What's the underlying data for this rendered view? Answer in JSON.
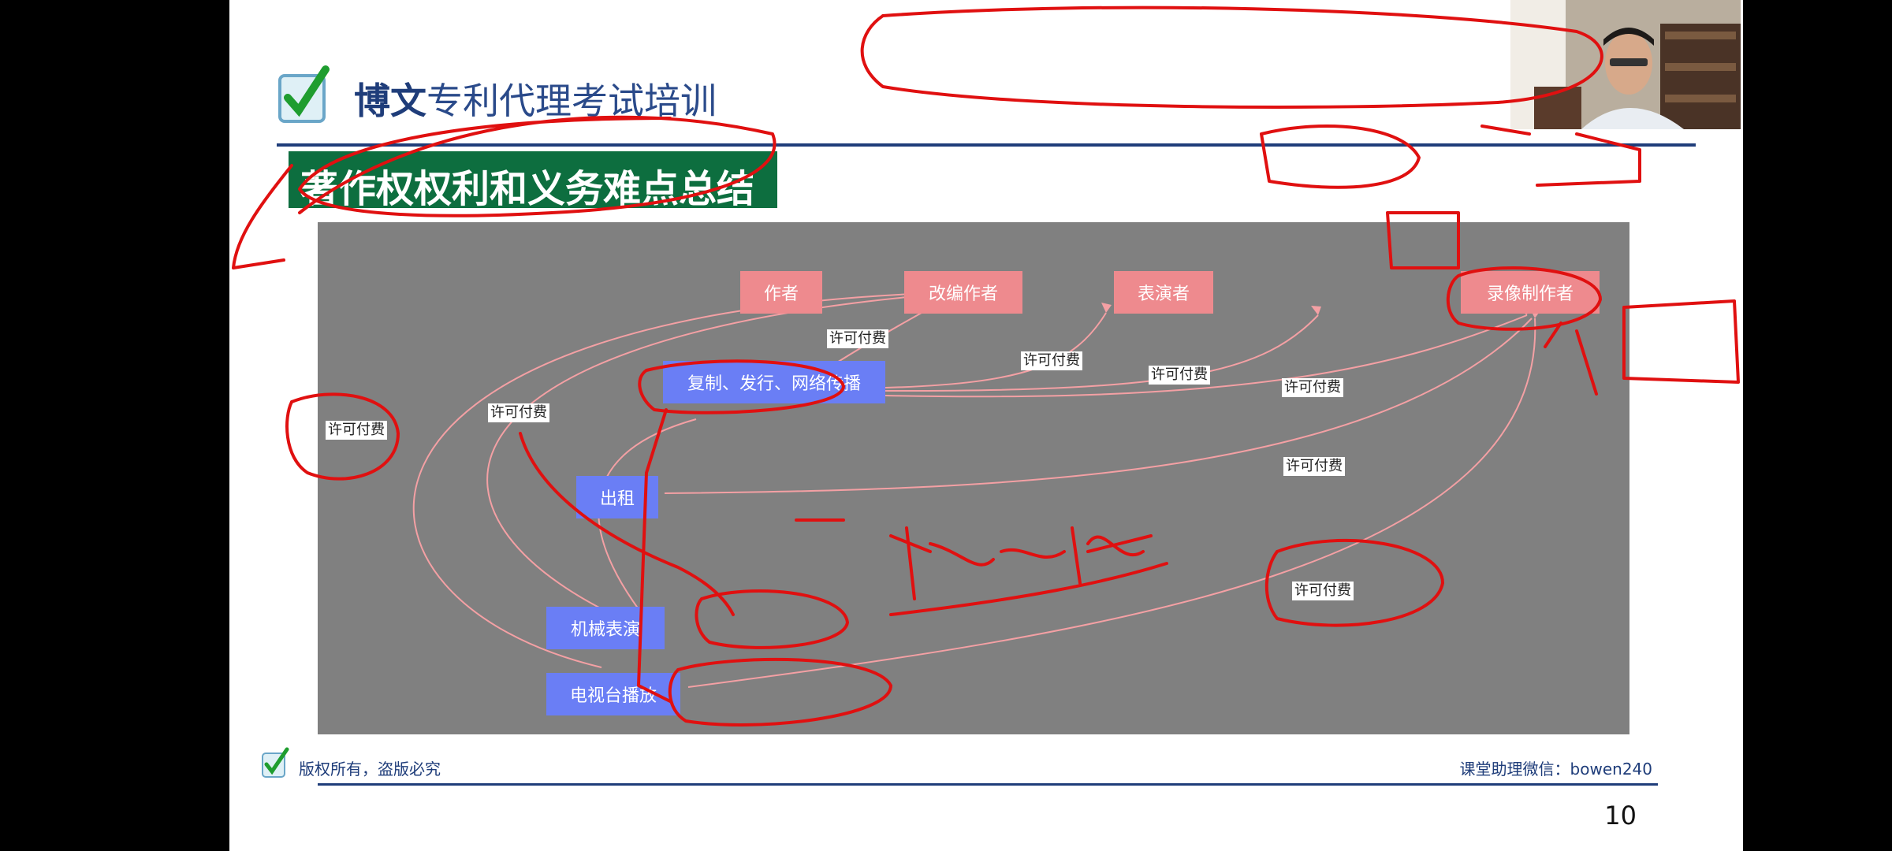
{
  "slide": {
    "brand_bold": "博文",
    "brand_rest": "专利代理考试培训",
    "title": "著作权权利和义务难点总结",
    "footer_left": "版权所有，盗版必究",
    "footer_right": "课堂助理微信：bowen240",
    "page_number": "10"
  },
  "diagram": {
    "rights_holders": [
      {
        "id": "author",
        "label": "作者"
      },
      {
        "id": "adapter",
        "label": "改编作者"
      },
      {
        "id": "performer",
        "label": "表演者"
      },
      {
        "id": "producer",
        "label": "录像制作者"
      }
    ],
    "uses": [
      {
        "id": "copy",
        "label": "复制、发行、网络传播"
      },
      {
        "id": "rent",
        "label": "出租"
      },
      {
        "id": "mech",
        "label": "机械表演"
      },
      {
        "id": "tv",
        "label": "电视台播放"
      }
    ],
    "edge_labels": [
      "许可付费",
      "许可付费",
      "许可付费",
      "许可付费",
      "许可付费",
      "许可付费",
      "许可付费",
      "许可付费"
    ]
  },
  "colors": {
    "holder_node": "#ee8a8e",
    "use_node": "#6a7ef5",
    "title_band": "#0d6e3f",
    "brand": "#1f3d7a",
    "canvas": "#808080",
    "ink": "#e01010"
  }
}
